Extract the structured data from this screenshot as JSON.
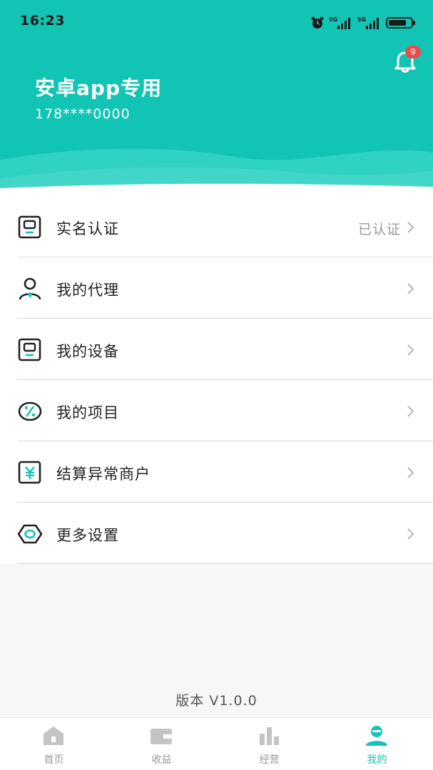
{
  "status_bar": {
    "time": "16:23",
    "icons": [
      "alarm-icon",
      "signal-5g-icon",
      "signal-5g-icon",
      "battery-icon"
    ]
  },
  "header": {
    "user_name": "安卓app专用",
    "phone": "178****0000",
    "notification_count": "9",
    "background_color": "#12c4b4"
  },
  "menu": {
    "items": [
      {
        "label": "实名认证",
        "value": "已认证",
        "icon": "id-card-icon"
      },
      {
        "label": "我的代理",
        "value": "",
        "icon": "agent-user-icon"
      },
      {
        "label": "我的设备",
        "value": "",
        "icon": "device-icon"
      },
      {
        "label": "我的项目",
        "value": "",
        "icon": "percent-icon"
      },
      {
        "label": "结算异常商户",
        "value": "",
        "icon": "yuan-icon"
      },
      {
        "label": "更多设置",
        "value": "",
        "icon": "settings-hexagon-icon"
      }
    ]
  },
  "version": "版本 V1.0.0",
  "tabbar": {
    "tabs": [
      {
        "label": "首页",
        "icon": "home-icon",
        "active": false
      },
      {
        "label": "收益",
        "icon": "wallet-icon",
        "active": false
      },
      {
        "label": "经营",
        "icon": "bar-chart-icon",
        "active": false
      },
      {
        "label": "我的",
        "icon": "profile-icon",
        "active": true
      }
    ],
    "active_color": "#12c4b4",
    "inactive_color": "#c4c4c4"
  }
}
